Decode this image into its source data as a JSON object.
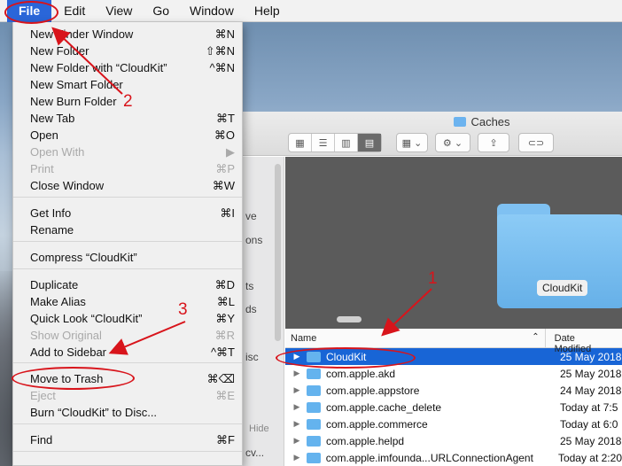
{
  "menubar": {
    "items": [
      "File",
      "Edit",
      "View",
      "Go",
      "Window",
      "Help"
    ],
    "active": "File"
  },
  "file_menu": {
    "items": [
      {
        "label": "New Finder Window",
        "shortcut": "⌘N",
        "enabled": true
      },
      {
        "label": "New Folder",
        "shortcut": "⇧⌘N",
        "enabled": true
      },
      {
        "label": "New Folder with “CloudKit”",
        "shortcut": "^⌘N",
        "enabled": true
      },
      {
        "label": "New Smart Folder",
        "shortcut": "",
        "enabled": true
      },
      {
        "label": "New Burn Folder",
        "shortcut": "",
        "enabled": true
      },
      {
        "label": "New Tab",
        "shortcut": "⌘T",
        "enabled": true
      },
      {
        "label": "Open",
        "shortcut": "⌘O",
        "enabled": true
      },
      {
        "label": "Open With",
        "shortcut": "▶",
        "enabled": false
      },
      {
        "label": "Print",
        "shortcut": "⌘P",
        "enabled": false
      },
      {
        "label": "Close Window",
        "shortcut": "⌘W",
        "enabled": true
      },
      {
        "label": "Get Info",
        "shortcut": "⌘I",
        "enabled": true
      },
      {
        "label": "Rename",
        "shortcut": "",
        "enabled": true
      },
      {
        "label": "Compress “CloudKit”",
        "shortcut": "",
        "enabled": true
      },
      {
        "label": "Duplicate",
        "shortcut": "⌘D",
        "enabled": true
      },
      {
        "label": "Make Alias",
        "shortcut": "⌘L",
        "enabled": true
      },
      {
        "label": "Quick Look “CloudKit”",
        "shortcut": "⌘Y",
        "enabled": true
      },
      {
        "label": "Show Original",
        "shortcut": "⌘R",
        "enabled": false
      },
      {
        "label": "Add to Sidebar",
        "shortcut": "^⌘T",
        "enabled": true
      },
      {
        "label": "Move to Trash",
        "shortcut": "⌘⌫",
        "enabled": true
      },
      {
        "label": "Eject",
        "shortcut": "⌘E",
        "enabled": false
      },
      {
        "label": "Burn “CloudKit” to Disc...",
        "shortcut": "",
        "enabled": true
      },
      {
        "label": "Find",
        "shortcut": "⌘F",
        "enabled": true
      }
    ]
  },
  "finder": {
    "title": "Caches",
    "sidebar_fragments": [
      "ve",
      "ons",
      "ts",
      "ds",
      "isc",
      "cv..."
    ],
    "sidebar_hide": "Hide",
    "preview_label": "CloudKit",
    "columns": {
      "name": "Name",
      "date": "Date Modified"
    },
    "rows": [
      {
        "name": "CloudKit",
        "date": "25 May 2018",
        "selected": true
      },
      {
        "name": "com.apple.akd",
        "date": "25 May 2018",
        "selected": false
      },
      {
        "name": "com.apple.appstore",
        "date": "24 May 2018",
        "selected": false
      },
      {
        "name": "com.apple.cache_delete",
        "date": "Today at 7:5",
        "selected": false
      },
      {
        "name": "com.apple.commerce",
        "date": "Today at 6:0",
        "selected": false
      },
      {
        "name": "com.apple.helpd",
        "date": "25 May 2018",
        "selected": false
      },
      {
        "name": "com.apple.imfounda...URLConnectionAgent",
        "date": "Today at 2:20",
        "selected": false
      }
    ]
  },
  "annotations": {
    "step1": "1",
    "step2": "2",
    "step3": "3"
  },
  "colors": {
    "annotation": "#d8141b",
    "selection": "#1865d6",
    "menubar_active": "#2a66d9",
    "folder": "#64b3ee"
  }
}
